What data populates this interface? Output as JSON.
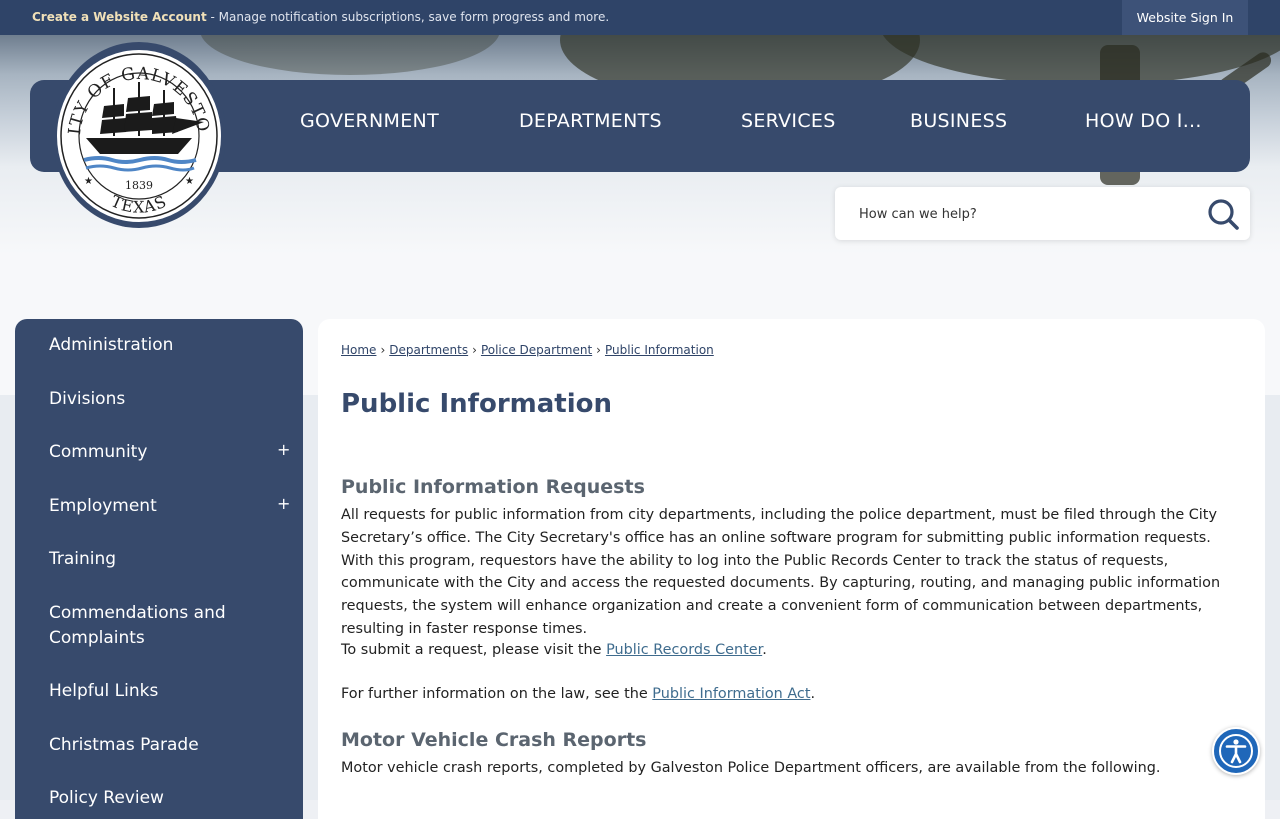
{
  "topbar": {
    "account_link": "Create a Website Account",
    "account_desc": " - Manage notification subscriptions, save form progress and more.",
    "signin": "Website Sign In"
  },
  "seal": {
    "top_text": "CITY OF GALVESTON",
    "year": "1839",
    "bottom_text": "TEXAS"
  },
  "nav": {
    "government": "GOVERNMENT",
    "departments": "DEPARTMENTS",
    "services": "SERVICES",
    "business": "BUSINESS",
    "how_do_i": "HOW DO I..."
  },
  "search": {
    "placeholder": "How can we help?"
  },
  "sidebar": {
    "items": [
      {
        "label": "Administration"
      },
      {
        "label": "Divisions"
      },
      {
        "label": "Community",
        "expand": "+"
      },
      {
        "label": "Employment",
        "expand": "+"
      },
      {
        "label": "Training"
      },
      {
        "label": "Commendations and Complaints"
      },
      {
        "label": "Helpful Links"
      },
      {
        "label": "Christmas Parade"
      },
      {
        "label": "Policy Review"
      }
    ]
  },
  "breadcrumb": {
    "home": "Home",
    "departments": "Departments",
    "police": "Police Department",
    "current": "Public Information",
    "sep": "›"
  },
  "main": {
    "title": "Public Information",
    "section1": {
      "heading": "Public Information Requests",
      "body": "All requests for public information from city departments, including the police department, must be filed through the City Secretary’s office. The City Secretary's office has an online software program for submitting public information requests. With this program, requestors have the ability to log into the Public Records Center to track the status of requests, communicate with the City and access the requested documents. By capturing, routing, and managing public information requests, the system will enhance organization and create a convenient form of communication between departments, resulting in faster response times.",
      "submit_prefix": "To submit a request, please visit the ",
      "submit_link": "Public Records Center",
      "submit_suffix": ".",
      "law_prefix": "For further information on the law, see the ",
      "law_link": "Public Information Act",
      "law_suffix": "."
    },
    "section2": {
      "heading": "Motor Vehicle Crash Reports",
      "body": "Motor vehicle crash reports, completed by Galveston Police Department officers, are available from the following."
    }
  },
  "colors": {
    "navy": "#374a6c",
    "topbar": "#2f4468",
    "link": "#3f6c8e",
    "a11y": "#1f67b9"
  }
}
